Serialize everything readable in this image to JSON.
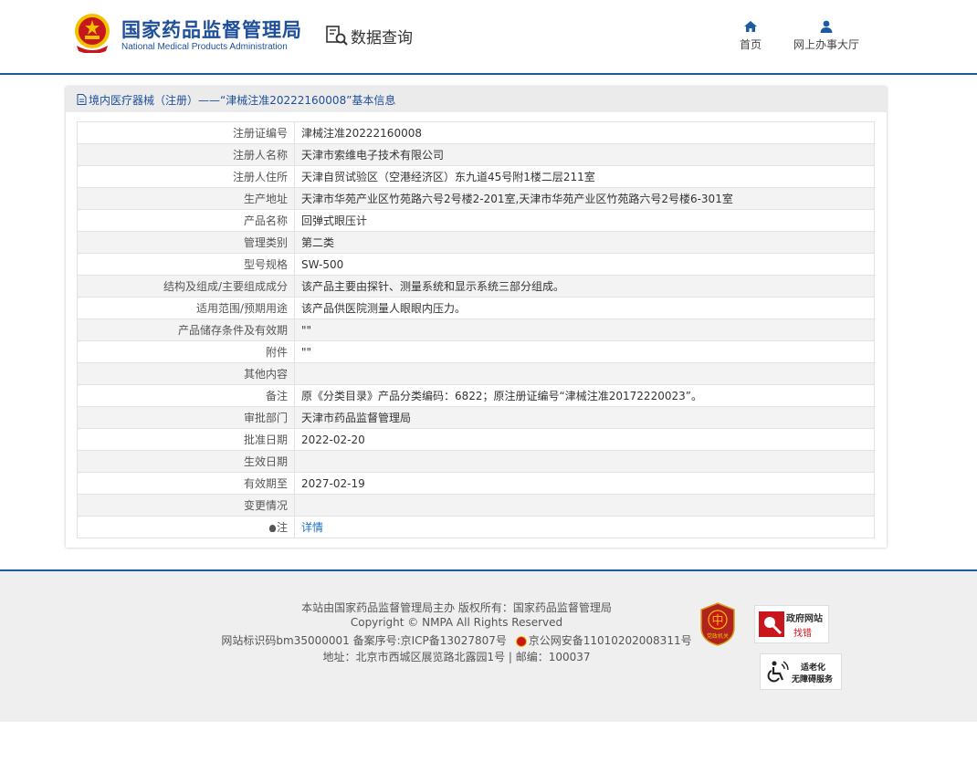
{
  "header": {
    "org_name_cn": "国家药品监督管理局",
    "org_name_en": "National Medical Products Administration",
    "data_query_label": "数据查询",
    "nav": [
      {
        "label": "首页",
        "icon": "home-icon"
      },
      {
        "label": "网上办事大厅",
        "icon": "user-icon"
      }
    ]
  },
  "panel": {
    "title": "境内医疗器械（注册）——“津械注准20222160008”基本信息"
  },
  "rows": [
    {
      "key": "注册证编号",
      "value": "津械注准20222160008"
    },
    {
      "key": "注册人名称",
      "value": "天津市索维电子技术有限公司"
    },
    {
      "key": "注册人住所",
      "value": "天津自贸试验区（空港经济区）东九道45号附1楼二层211室"
    },
    {
      "key": "生产地址",
      "value": "天津市华苑产业区竹苑路六号2号楼2-201室,天津市华苑产业区竹苑路六号2号楼6-301室"
    },
    {
      "key": "产品名称",
      "value": "回弹式眼压计"
    },
    {
      "key": "管理类别",
      "value": "第二类"
    },
    {
      "key": "型号规格",
      "value": "SW-500"
    },
    {
      "key": "结构及组成/主要组成成分",
      "value": "该产品主要由探针、测量系统和显示系统三部分组成。"
    },
    {
      "key": "适用范围/预期用途",
      "value": "该产品供医院测量人眼眼内压力。"
    },
    {
      "key": "产品储存条件及有效期",
      "value": "\"\""
    },
    {
      "key": "附件",
      "value": "\"\""
    },
    {
      "key": "其他内容",
      "value": ""
    },
    {
      "key": "备注",
      "value": "原《分类目录》产品分类编码：6822；原注册证编号“津械注准20172220023”。"
    },
    {
      "key": "审批部门",
      "value": "天津市药品监督管理局"
    },
    {
      "key": "批准日期",
      "value": "2022-02-20"
    },
    {
      "key": "生效日期",
      "value": ""
    },
    {
      "key": "有效期至",
      "value": "2027-02-19"
    },
    {
      "key": "变更情况",
      "value": ""
    }
  ],
  "note_row": {
    "key": "注",
    "link": "详情"
  },
  "footer": {
    "line1": "本站由国家药品监督管理局主办 版权所有：国家药品监督管理局",
    "line2": "Copyright © NMPA All Rights Reserved",
    "line3a": "网站标识码bm35000001    备案序号:京ICP备13027807号",
    "line3b": "京公网安备11010202008311号",
    "line4": "地址：北京市西城区展览路北露园1号 | 邮编：100037",
    "badge_gov_line1": "政府网站",
    "badge_gov_line2": "找错",
    "badge_acc_line1": "适老化",
    "badge_acc_line2": "无障碍服务",
    "badge_red_text": "党政机关"
  },
  "colors": {
    "brand_blue": "#1d4f9a",
    "rule_blue": "#1d5aa6",
    "link_blue": "#1d6fc0",
    "emblem_red": "#c8161d",
    "emblem_gold": "#f2c200"
  }
}
